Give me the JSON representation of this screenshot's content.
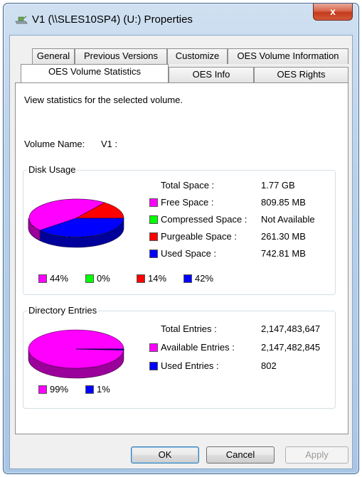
{
  "window": {
    "title": "V1 (\\\\SLES10SP4) (U:) Properties",
    "close_label": "x"
  },
  "tabs_row1": [
    {
      "label": "General"
    },
    {
      "label": "Previous Versions"
    },
    {
      "label": "Customize"
    },
    {
      "label": "OES Volume Information"
    }
  ],
  "tabs_row2": [
    {
      "label": "OES Volume Statistics",
      "active": true
    },
    {
      "label": "OES Info"
    },
    {
      "label": "OES Rights"
    }
  ],
  "panel": {
    "description": "View statistics for the selected volume.",
    "volume_name_label": "Volume Name:",
    "volume_name_value": "V1 :"
  },
  "disk_usage": {
    "title": "Disk Usage",
    "total_label": "Total Space :",
    "total_value": "1.77 GB",
    "rows": [
      {
        "label": "Free Space :",
        "value": "809.85 MB",
        "color": "#ff00ff"
      },
      {
        "label": "Compressed Space :",
        "value": "Not Available",
        "color": "#00ff00"
      },
      {
        "label": "Purgeable Space :",
        "value": "261.30 MB",
        "color": "#ff0000"
      },
      {
        "label": "Used Space :",
        "value": "742.81 MB",
        "color": "#0000ff"
      }
    ],
    "legend": [
      {
        "pct": "44%",
        "color": "#ff00ff"
      },
      {
        "pct": "0%",
        "color": "#00ff00"
      },
      {
        "pct": "14%",
        "color": "#ff0000"
      },
      {
        "pct": "42%",
        "color": "#0000ff"
      }
    ]
  },
  "directory_entries": {
    "title": "Directory Entries",
    "total_label": "Total Entries :",
    "total_value": "2,147,483,647",
    "rows": [
      {
        "label": "Available Entries :",
        "value": "2,147,482,845",
        "color": "#ff00ff"
      },
      {
        "label": "Used Entries :",
        "value": "802",
        "color": "#0000ff"
      }
    ],
    "legend": [
      {
        "pct": "99%",
        "color": "#ff00ff"
      },
      {
        "pct": "1%",
        "color": "#0000ff"
      }
    ]
  },
  "buttons": {
    "ok": "OK",
    "cancel": "Cancel",
    "apply": "Apply"
  }
}
